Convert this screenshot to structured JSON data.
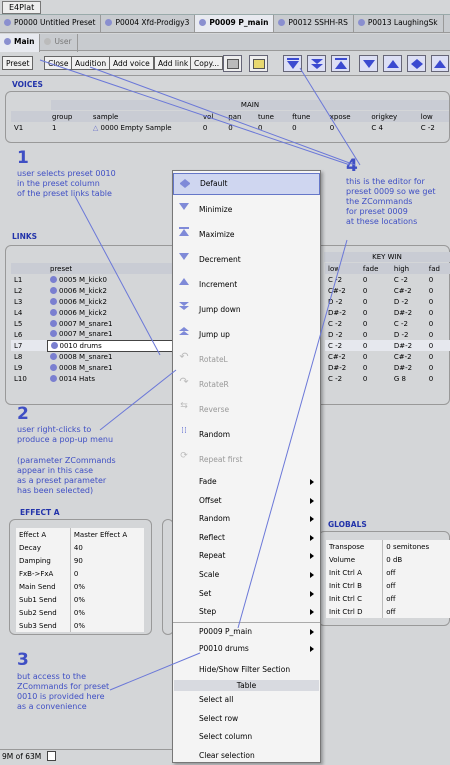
{
  "window": {
    "title": "E4Plat"
  },
  "preset_tabs": [
    {
      "label": "P0000 Untitled Preset",
      "active": false
    },
    {
      "label": "P0004 Xfd-Prodigy3",
      "active": false
    },
    {
      "label": "P0009 P_main",
      "active": true
    },
    {
      "label": "P0012 SSHH-RS",
      "active": false
    },
    {
      "label": "P0013 LaughingSk",
      "active": false
    }
  ],
  "view_tabs": [
    {
      "label": "Main",
      "active": true
    },
    {
      "label": "User",
      "active": false
    }
  ],
  "toolbar": {
    "preset": "Preset",
    "close": "Close",
    "audition": "Audition",
    "add_voice": "Add voice",
    "add_link": "Add link",
    "copy": "Copy..."
  },
  "voices": {
    "section": "VOICES",
    "group_title": "MAIN",
    "headers": [
      "group",
      "sample",
      "vol",
      "pan",
      "tune",
      "ftune",
      "xpose",
      "origkey",
      "low"
    ],
    "row": {
      "id": "V1",
      "group": "1",
      "sample": "0000 Empty Sample",
      "vol": "0",
      "pan": "0",
      "tune": "0",
      "ftune": "0",
      "xpose": "0",
      "origkey": "C  4",
      "low": "C -2"
    }
  },
  "links": {
    "section": "LINKS",
    "keywin": "KEY WIN",
    "headers": {
      "preset": "preset",
      "low": "low",
      "fade": "fade",
      "high": "high",
      "fade2": "fad"
    },
    "rows": [
      {
        "id": "L1",
        "preset": "0005 M_kick0",
        "low": "C -2",
        "fade": "0",
        "high": "C -2",
        "fade2": "0"
      },
      {
        "id": "L2",
        "preset": "0006 M_kick2",
        "low": "C#-2",
        "fade": "0",
        "high": "C#-2",
        "fade2": "0"
      },
      {
        "id": "L3",
        "preset": "0006 M_kick2",
        "low": "D -2",
        "fade": "0",
        "high": "D -2",
        "fade2": "0"
      },
      {
        "id": "L4",
        "preset": "0006 M_kick2",
        "low": "D#-2",
        "fade": "0",
        "high": "D#-2",
        "fade2": "0"
      },
      {
        "id": "L5",
        "preset": "0007 M_snare1",
        "low": "C -2",
        "fade": "0",
        "high": "C -2",
        "fade2": "0"
      },
      {
        "id": "L6",
        "preset": "0007 M_snare1",
        "low": "D -2",
        "fade": "0",
        "high": "D -2",
        "fade2": "0"
      },
      {
        "id": "L7",
        "preset": "0010 drums",
        "low": "C -2",
        "fade": "0",
        "high": "D#-2",
        "fade2": "0"
      },
      {
        "id": "L8",
        "preset": "0008 M_snare1",
        "low": "C#-2",
        "fade": "0",
        "high": "C#-2",
        "fade2": "0"
      },
      {
        "id": "L9",
        "preset": "0008 M_snare1",
        "low": "D#-2",
        "fade": "0",
        "high": "D#-2",
        "fade2": "0"
      },
      {
        "id": "L10",
        "preset": "0014 Hats",
        "low": "C -2",
        "fade": "0",
        "high": "G  8",
        "fade2": "0"
      }
    ]
  },
  "effect_a": {
    "section": "EFFECT A",
    "rows": [
      [
        "Effect A",
        "Master Effect A"
      ],
      [
        "Decay",
        "40"
      ],
      [
        "Damping",
        "90"
      ],
      [
        "FxB->FxA",
        "0"
      ],
      [
        "Main Send",
        "0%"
      ],
      [
        "Sub1 Send",
        "0%"
      ],
      [
        "Sub2 Send",
        "0%"
      ],
      [
        "Sub3 Send",
        "0%"
      ]
    ]
  },
  "globals": {
    "section": "GLOBALS",
    "rows": [
      [
        "Transpose",
        "0 semitones"
      ],
      [
        "Volume",
        "0 dB"
      ],
      [
        "Init Ctrl A",
        "off"
      ],
      [
        "Init Ctrl B",
        "off"
      ],
      [
        "Init Ctrl C",
        "off"
      ],
      [
        "Init Ctrl D",
        "off"
      ]
    ]
  },
  "menu": {
    "items": [
      {
        "label": "Default",
        "icon": "default-icon",
        "disabled": false,
        "highlight": true
      },
      {
        "label": "Minimize",
        "icon": "minimize-icon",
        "disabled": false
      },
      {
        "label": "Maximize",
        "icon": "maximize-icon",
        "disabled": false
      },
      {
        "label": "Decrement",
        "icon": "decrement-icon",
        "disabled": false
      },
      {
        "label": "Increment",
        "icon": "increment-icon",
        "disabled": false
      },
      {
        "label": "Jump down",
        "icon": "jump-down-icon",
        "disabled": false
      },
      {
        "label": "Jump up",
        "icon": "jump-up-icon",
        "disabled": false
      },
      {
        "label": "RotateL",
        "icon": "rotate-left-icon",
        "disabled": true
      },
      {
        "label": "RotateR",
        "icon": "rotate-right-icon",
        "disabled": true
      },
      {
        "label": "Reverse",
        "icon": "reverse-icon",
        "disabled": true
      },
      {
        "label": "Random",
        "icon": "random-icon",
        "disabled": false
      },
      {
        "label": "Repeat first",
        "icon": "repeat-first-icon",
        "disabled": true
      }
    ],
    "submenus": [
      "Fade",
      "Offset",
      "Random",
      "Reflect",
      "Repeat",
      "Scale",
      "Set",
      "Step",
      "P0009 P_main",
      "P0010 drums"
    ],
    "extra": "Hide/Show Filter Section",
    "table_header": "Table",
    "table_items": [
      "Select all",
      "Select row",
      "Select column",
      "Clear selection"
    ]
  },
  "annotations": {
    "n1": "1",
    "t1": [
      "user selects preset 0010",
      "in the preset column",
      "of the preset links table"
    ],
    "n2": "2",
    "t2": [
      "user right-clicks to",
      "produce a pop-up menu"
    ],
    "t2b": [
      "(parameter ZCommands",
      "appear in this case",
      "as a preset parameter",
      "has been selected)"
    ],
    "n3": "3",
    "t3": [
      "but access to the",
      "ZCommands for preset",
      "0010 is provided here",
      "as a convenience"
    ],
    "n4": "4",
    "t4": [
      "this is the editor for",
      "preset 0009 so we get",
      "the ZCommands",
      "for preset 0009",
      "at these locations"
    ]
  },
  "status": {
    "memory": "9M of 63M"
  },
  "colors": {
    "annotation": "#3f4fc4",
    "accent": "#3b4ad0"
  }
}
